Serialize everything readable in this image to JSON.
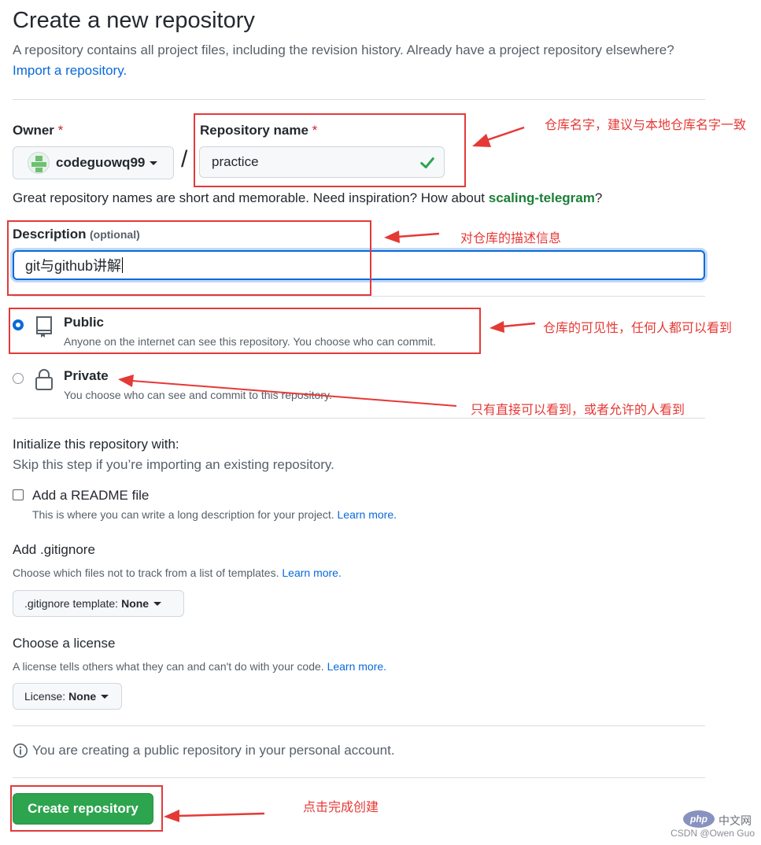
{
  "header": {
    "title": "Create a new repository",
    "subtitle": "A repository contains all project files, including the revision history. Already have a project repository elsewhere?",
    "import_link": "Import a repository."
  },
  "owner": {
    "label": "Owner",
    "required_mark": "*",
    "value": "codeguowq99"
  },
  "slash": "/",
  "repo_name": {
    "label": "Repository name",
    "required_mark": "*",
    "value": "practice"
  },
  "hint": {
    "prefix": "Great repository names are short and memorable. Need inspiration? How about ",
    "suggestion": "scaling-telegram",
    "suffix": "?"
  },
  "description": {
    "label": "Description",
    "optional": "(optional)",
    "value": "git与github讲解"
  },
  "visibility": {
    "selected": "public",
    "public": {
      "title": "Public",
      "desc": "Anyone on the internet can see this repository. You choose who can commit."
    },
    "private": {
      "title": "Private",
      "desc": "You choose who can see and commit to this repository."
    }
  },
  "init": {
    "title": "Initialize this repository with:",
    "desc": "Skip this step if you’re importing an existing repository.",
    "readme_label": "Add a README file",
    "readme_desc": "This is where you can write a long description for your project.",
    "readme_checked": false,
    "learn_more": "Learn more."
  },
  "gitignore": {
    "title": "Add .gitignore",
    "desc": "Choose which files not to track from a list of templates.",
    "learn_more": "Learn more.",
    "button_label": ".gitignore template:",
    "button_value": "None"
  },
  "license": {
    "title": "Choose a license",
    "desc": "A license tells others what they can and can't do with your code.",
    "learn_more": "Learn more.",
    "button_label": "License:",
    "button_value": "None"
  },
  "info_text": "You are creating a public repository in your personal account.",
  "create_button": "Create repository",
  "annotations": {
    "repo_name": "仓库名字，建议与本地仓库名字一致",
    "description": "对仓库的描述信息",
    "public": "仓库的可见性，任何人都可以看到",
    "private": "只有直接可以看到，或者允许的人看到",
    "create": "点击完成创建"
  },
  "watermark": {
    "php": "php",
    "cn": "中文网",
    "csdn": "CSDN @Owen Guo"
  },
  "colors": {
    "link": "#0969da",
    "accent_green": "#2da44e",
    "annotation_red": "#e53935"
  }
}
